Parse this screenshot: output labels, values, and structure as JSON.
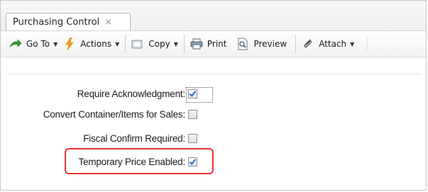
{
  "tab": {
    "title": "Purchasing Control",
    "close_glyph": "×"
  },
  "toolbar": {
    "goto_label": "Go To",
    "actions_label": "Actions",
    "copy_label": "Copy",
    "print_label": "Print",
    "preview_label": "Preview",
    "attach_label": "Attach",
    "caret": "▼"
  },
  "form": {
    "fields": [
      {
        "label": "Require Acknowledgment:",
        "checked": true
      },
      {
        "label": "Convert Container/Items for Sales:",
        "checked": false
      },
      {
        "label": "Fiscal Confirm Required:",
        "checked": false
      },
      {
        "label": "Temporary Price Enabled:",
        "checked": true
      }
    ]
  },
  "icons": {
    "goto": "arrow-right-icon",
    "actions": "lightning-icon",
    "copy": "copy-icon",
    "print": "printer-icon",
    "preview": "preview-icon",
    "attach": "paperclip-icon"
  },
  "colors": {
    "highlight": "#e53333",
    "checkmark": "#2a5fc0",
    "goto_icon": "#2e9e2e",
    "actions_icon": "#f3a21b"
  }
}
